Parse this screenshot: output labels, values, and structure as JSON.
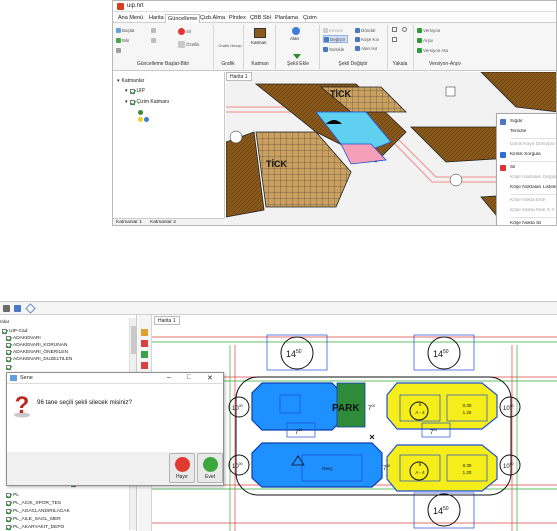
{
  "app1": {
    "title": "uip.hrt",
    "menu_tabs": [
      "Ana Menü",
      "Harita",
      "Güncelleme",
      "Çizb.Alma",
      "Plndex",
      "ÇBB Sbl",
      "Planlama",
      "Çizim"
    ],
    "ribbon": {
      "groups": [
        "Güncelleme Başlat-Bitir",
        "Grafik",
        "Katman",
        "Şekil Ekle",
        "Şekil Değiştir",
        "Yakala",
        "Versiyon-Arşiv"
      ],
      "buttons": {
        "baslat": "Başlat",
        "bitir": "Bitir",
        "sil": "Sil",
        "ozellik": "Özellik",
        "grafik_hesap": "Grafik Hesap",
        "katman": "Katman",
        "alan": "Alan",
        "dondur": "Döndür",
        "degistir": "Değiştir",
        "kose_kiv": "Köşe Kıv",
        "surukle": "Sürükle",
        "alan_isit": "Alan Isıt",
        "versiyon": "Versiyon",
        "arsiv": "Arşiv",
        "versiyon_ata": "Versiyon Ata"
      }
    },
    "sidebar": {
      "root": "Katmanlar",
      "items": [
        "UIP",
        "Çizim Katmanı"
      ],
      "tabs": [
        "Katmanlar 1",
        "Katmanlar 2"
      ]
    },
    "map_tab": "Harita 1",
    "map_labels": {
      "tick1": "TİCK",
      "tick2": "TİCK"
    },
    "context_menu": [
      {
        "label": "Sığdır",
        "enabled": true,
        "icon_color": "#4a78c2"
      },
      {
        "label": "Temizle",
        "enabled": true,
        "icon_color": "#ffffff"
      },
      {
        "label": "Dahili Kayıt Dönüştür",
        "enabled": false,
        "icon_color": "#ffffff"
      },
      {
        "label": "Kimlik Sorgula",
        "enabled": true,
        "icon_color": "#2d6fd6"
      },
      {
        "label": "Sil",
        "enabled": true,
        "icon_color": "#e03030"
      },
      {
        "label": "Köşe Noktaları Değiştir",
        "enabled": false,
        "icon_color": "#ffffff"
      },
      {
        "label": "Köşe Noktaları Listele",
        "enabled": true,
        "icon_color": "#ffffff"
      },
      {
        "label": "Köşe Nokta Ekle",
        "enabled": false,
        "icon_color": "#ffffff"
      },
      {
        "label": "Köşe Nokta Ekle X,Y",
        "enabled": false,
        "icon_color": "#ffffff"
      },
      {
        "label": "Köşe Nokta Sil",
        "enabled": true,
        "icon_color": "#ffffff"
      },
      {
        "label": "Köşe Nokta XY Ata",
        "enabled": true,
        "icon_color": "#ffffff"
      }
    ]
  },
  "app2": {
    "map_tab": "Harita 1",
    "layers": [
      "UIP-Cad",
      "ADAKENARI",
      "ADAKENARI_KORUNAN",
      "ADAKENARI_ÖNERİLEN",
      "ADAKENARI_DUZELTILEN",
      "PL",
      "PL_ACIK_SPOR_TES",
      "PL_AGACLANDIRILACAK",
      "PL_AILE_SAGL_MER",
      "PL_AKARYAKIT_DEPO"
    ],
    "layers_header": "mlar",
    "map_labels": {
      "road_top_left": "14",
      "road_top_left_sup": "50",
      "road_top_right": "14",
      "road_top_right_sup": "50",
      "road_bottom": "14",
      "road_bottom_sup": "50",
      "side_left_top": "10",
      "side_left_top_sup": "00",
      "side_left_bottom": "10",
      "side_left_bottom_sup": "00",
      "side_right_top": "10",
      "side_right_top_sup": "00",
      "side_right_bottom": "10",
      "side_right_bottom_sup": "00",
      "mid1": "7",
      "mid1_sup": "00",
      "mid2": "7",
      "mid2_sup": "00",
      "mid3": "7",
      "mid3_sup": "50",
      "mid4": "7",
      "mid4_sup": "50",
      "park": "PARK",
      "a4_top": "A - 4",
      "a4_top_num": "5",
      "a4_bottom": "A - 4",
      "a4_bottom_num": "5",
      "ratio_top_1": "0.30",
      "ratio_top_2": "1.20",
      "ratio_bottom_1": "0.30",
      "ratio_bottom_2": "1.20",
      "blue_label": "Genç"
    },
    "dialog": {
      "title": "Sene",
      "message": "96 tane seçili şekli silecek misiniz?",
      "buttons": {
        "no": "Hayır",
        "yes": "Evet"
      },
      "window_controls": [
        "–",
        "□",
        "✕"
      ]
    }
  },
  "colors": {
    "yellow_parcel": "#f5ee1a",
    "blue_parcel": "#1e90ff",
    "brown_hatch": "#8b5a1b",
    "selection_blue": "#1f4fd8",
    "green_park": "#2e8b3a"
  }
}
